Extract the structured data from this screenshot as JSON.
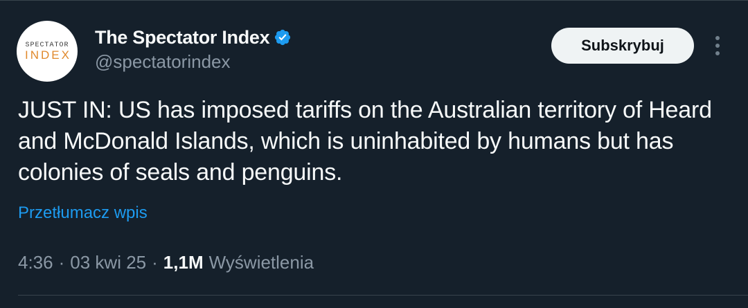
{
  "author": {
    "avatar": {
      "line1": "SPECTATOR",
      "line2": "INDEX"
    },
    "display_name": "The Spectator Index",
    "handle": "@spectatorindex",
    "verified": true
  },
  "actions": {
    "subscribe_label": "Subskrybuj",
    "more_icon": "more-vertical-icon"
  },
  "tweet": {
    "text": "JUST IN: US has imposed tariffs on the Australian territory of Heard and McDonald Islands, which is uninhabited by humans but has colonies of seals and penguins.",
    "translate_label": "Przetłumacz wpis"
  },
  "meta": {
    "time": "4:36",
    "separator": "·",
    "date": "03 kwi 25",
    "views_count": "1,1M",
    "views_label": "Wyświetlenia"
  },
  "colors": {
    "background": "#15202b",
    "accent_link": "#1d9bf0",
    "verified_badge": "#1d9bf0",
    "secondary_text": "#8b98a5",
    "avatar_accent": "#e0892c"
  }
}
